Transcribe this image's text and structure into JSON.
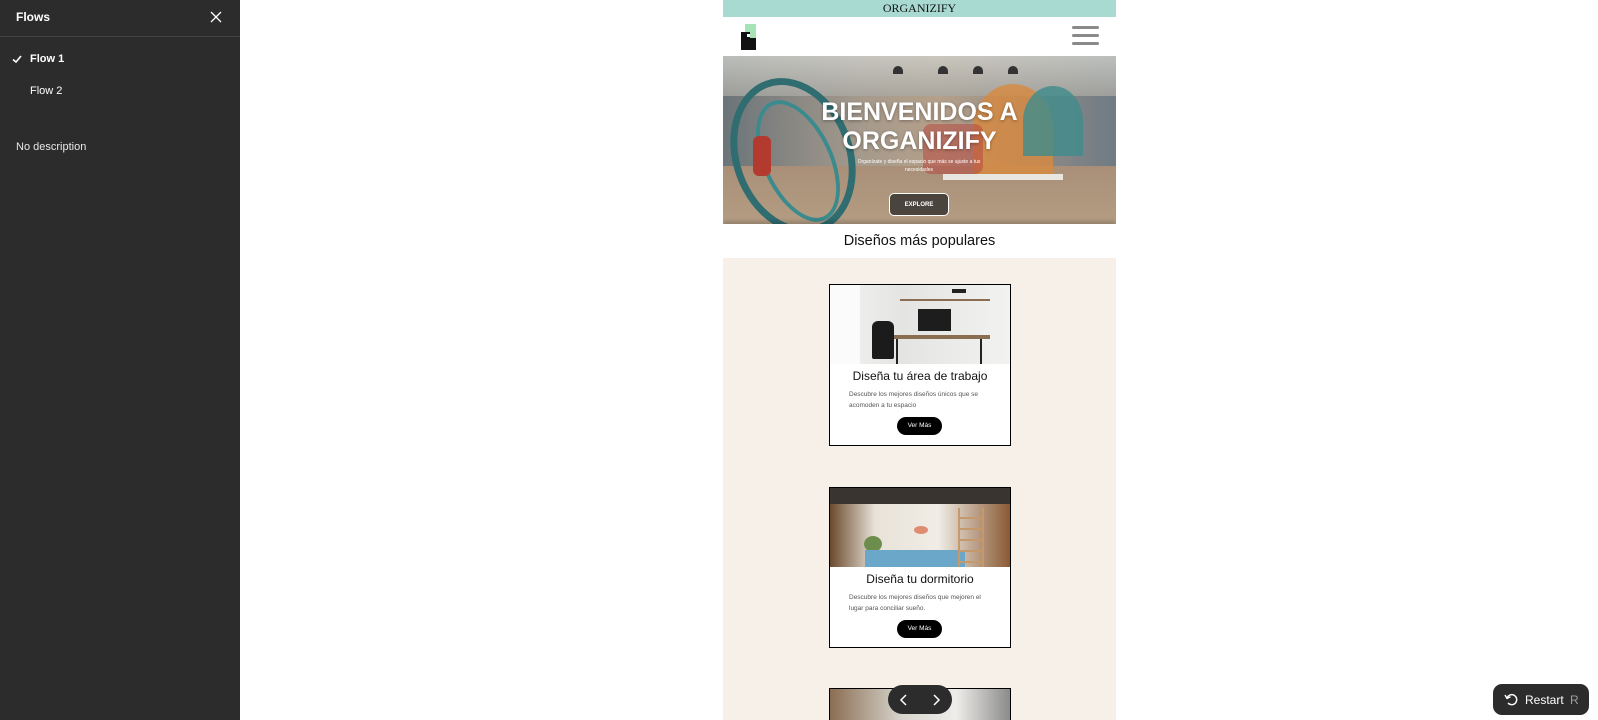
{
  "sidebar": {
    "title": "Flows",
    "close_icon": "close-icon",
    "flows": [
      {
        "label": "Flow 1",
        "selected": true
      },
      {
        "label": "Flow 2",
        "selected": false
      }
    ],
    "description": "No description"
  },
  "prototype": {
    "topbar_text": "ORGANIZIFY",
    "topbar_color": "#a8dad2",
    "hero": {
      "title_line1": "BIENVENIDOS A",
      "title_line2": "ORGANIZIFY",
      "subtitle": "Organízate y diseña el espacio que más se ajuste a tus necesidades",
      "button_label": "EXPLORE"
    },
    "section_title": "Diseños más populares",
    "background_color": "#f7f0e9",
    "cards": [
      {
        "title": "Diseña tu área de trabajo",
        "description": "Descubre los mejores diseños únicos que se acomoden a tu espacio",
        "button_label": "Ver Más"
      },
      {
        "title": "Diseña tu dormitorio",
        "description": "Descubre los mejores diseños que mejoren el lugar para conciliar sueño.",
        "button_label": "Ver Más"
      }
    ]
  },
  "navigation": {
    "prev_icon": "chevron-left-icon",
    "next_icon": "chevron-right-icon"
  },
  "restart": {
    "label": "Restart",
    "shortcut": "R",
    "icon": "restart-icon"
  }
}
